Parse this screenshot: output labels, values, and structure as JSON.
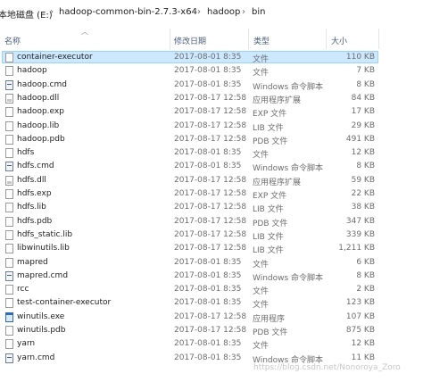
{
  "breadcrumb": {
    "drive": "本地磁盘 (E:)",
    "items": [
      "hadoop-common-bin-2.7.3-x64",
      "hadoop",
      "bin"
    ]
  },
  "columns": {
    "name": "名称",
    "date": "修改日期",
    "type": "类型",
    "size": "大小"
  },
  "files": [
    {
      "name": "container-executor",
      "date": "2017-08-01 8:35",
      "type": "文件",
      "size": "110 KB",
      "icon": "file-icon"
    },
    {
      "name": "hadoop",
      "date": "2017-08-01 8:35",
      "type": "文件",
      "size": "7 KB",
      "icon": "file-icon"
    },
    {
      "name": "hadoop.cmd",
      "date": "2017-08-01 8:35",
      "type": "Windows 命令脚本",
      "size": "8 KB",
      "icon": "cmd-icon"
    },
    {
      "name": "hadoop.dll",
      "date": "2017-08-17 12:58",
      "type": "应用程序扩展",
      "size": "84 KB",
      "icon": "dll-icon"
    },
    {
      "name": "hadoop.exp",
      "date": "2017-08-17 12:58",
      "type": "EXP 文件",
      "size": "17 KB",
      "icon": "file-icon"
    },
    {
      "name": "hadoop.lib",
      "date": "2017-08-17 12:58",
      "type": "LIB 文件",
      "size": "29 KB",
      "icon": "file-icon"
    },
    {
      "name": "hadoop.pdb",
      "date": "2017-08-17 12:58",
      "type": "PDB 文件",
      "size": "491 KB",
      "icon": "file-icon"
    },
    {
      "name": "hdfs",
      "date": "2017-08-01 8:35",
      "type": "文件",
      "size": "12 KB",
      "icon": "file-icon"
    },
    {
      "name": "hdfs.cmd",
      "date": "2017-08-01 8:35",
      "type": "Windows 命令脚本",
      "size": "8 KB",
      "icon": "cmd-icon"
    },
    {
      "name": "hdfs.dll",
      "date": "2017-08-17 12:58",
      "type": "应用程序扩展",
      "size": "59 KB",
      "icon": "dll-icon"
    },
    {
      "name": "hdfs.exp",
      "date": "2017-08-17 12:58",
      "type": "EXP 文件",
      "size": "22 KB",
      "icon": "file-icon"
    },
    {
      "name": "hdfs.lib",
      "date": "2017-08-17 12:58",
      "type": "LIB 文件",
      "size": "38 KB",
      "icon": "file-icon"
    },
    {
      "name": "hdfs.pdb",
      "date": "2017-08-17 12:58",
      "type": "PDB 文件",
      "size": "347 KB",
      "icon": "file-icon"
    },
    {
      "name": "hdfs_static.lib",
      "date": "2017-08-17 12:58",
      "type": "LIB 文件",
      "size": "339 KB",
      "icon": "file-icon"
    },
    {
      "name": "libwinutils.lib",
      "date": "2017-08-17 12:58",
      "type": "LIB 文件",
      "size": "1,211 KB",
      "icon": "file-icon"
    },
    {
      "name": "mapred",
      "date": "2017-08-01 8:35",
      "type": "文件",
      "size": "6 KB",
      "icon": "file-icon"
    },
    {
      "name": "mapred.cmd",
      "date": "2017-08-01 8:35",
      "type": "Windows 命令脚本",
      "size": "8 KB",
      "icon": "cmd-icon"
    },
    {
      "name": "rcc",
      "date": "2017-08-01 8:35",
      "type": "文件",
      "size": "2 KB",
      "icon": "file-icon"
    },
    {
      "name": "test-container-executor",
      "date": "2017-08-01 8:35",
      "type": "文件",
      "size": "123 KB",
      "icon": "file-icon"
    },
    {
      "name": "winutils.exe",
      "date": "2017-08-17 12:58",
      "type": "应用程序",
      "size": "107 KB",
      "icon": "exe-icon"
    },
    {
      "name": "winutils.pdb",
      "date": "2017-08-17 12:58",
      "type": "PDB 文件",
      "size": "875 KB",
      "icon": "file-icon"
    },
    {
      "name": "yarn",
      "date": "2017-08-01 8:35",
      "type": "文件",
      "size": "12 KB",
      "icon": "file-icon"
    },
    {
      "name": "yarn.cmd",
      "date": "2017-08-01 8:35",
      "type": "Windows 命令脚本",
      "size": "11 KB",
      "icon": "cmd-icon"
    }
  ],
  "selected_index": 0,
  "watermark": "https://blog.csdn.net/Nonoroya_Zoro"
}
